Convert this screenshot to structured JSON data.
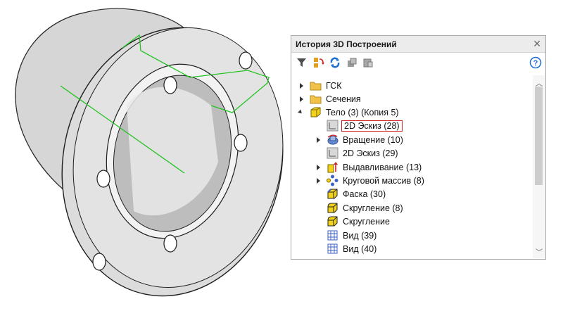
{
  "panel": {
    "title": "История 3D Построений",
    "close": "✕"
  },
  "toolbar": {
    "items": [
      "filter-icon",
      "tree-structure-icon",
      "refresh-icon",
      "part-tool-icon",
      "part-tool-2-icon",
      "help-icon"
    ],
    "help_label": "?"
  },
  "tree": {
    "items": [
      {
        "label": "ГСК",
        "icon": "folder-icon",
        "state": "collapsed"
      },
      {
        "label": "Сечения",
        "icon": "folder-icon",
        "state": "collapsed"
      },
      {
        "label": "Тело (3) (Копия 5)",
        "icon": "body-icon",
        "state": "expanded"
      },
      {
        "label": "2D Эскиз (28)",
        "icon": "sketch-icon",
        "state": "none",
        "selected": true
      },
      {
        "label": "Вращение (10)",
        "icon": "revolve-icon",
        "state": "collapsed"
      },
      {
        "label": "2D Эскиз (29)",
        "icon": "sketch-icon",
        "state": "none"
      },
      {
        "label": "Выдавливание (13)",
        "icon": "extrude-icon",
        "state": "collapsed"
      },
      {
        "label": "Круговой массив (8)",
        "icon": "circular-array-icon",
        "state": "collapsed"
      },
      {
        "label": "Фаска (30)",
        "icon": "chamfer-icon",
        "state": "none"
      },
      {
        "label": "Скругление (8)",
        "icon": "fillet-icon",
        "state": "none"
      },
      {
        "label": "Скругление",
        "icon": "fillet-icon",
        "state": "none"
      },
      {
        "label": "Вид (39)",
        "icon": "view-icon",
        "state": "none"
      },
      {
        "label": "Вид (40)",
        "icon": "view-icon",
        "state": "none"
      }
    ]
  },
  "scroll": {
    "up": "︿",
    "down": "﹀"
  },
  "colors": {
    "sketch_line": "#22c322",
    "selection_border": "#d11f1f",
    "folder": "#f0c24a",
    "body": "#f2d21b"
  }
}
